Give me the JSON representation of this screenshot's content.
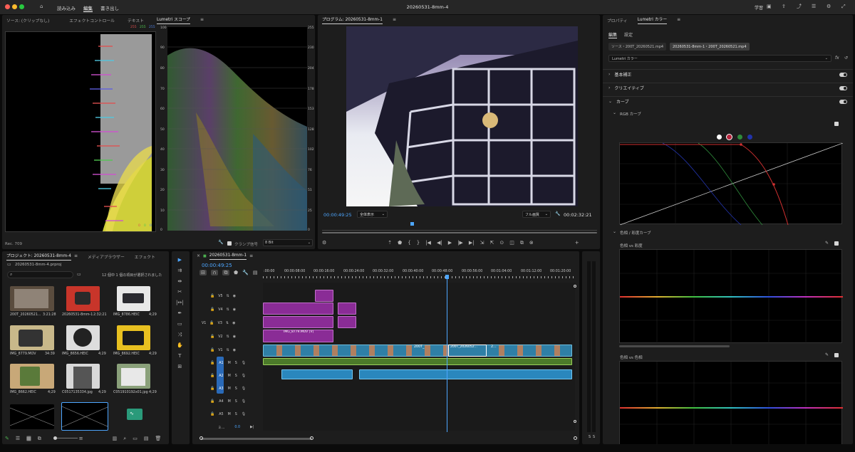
{
  "window": {
    "title": "20260531-8mm-4"
  },
  "menu": {
    "import": "読み込み",
    "edit": "編集",
    "export": "書き出し"
  },
  "titlebar_right": {
    "learn": "学習"
  },
  "source_panel": {
    "tabs": [
      "ソース: (クリップなし)",
      "エフェクトコントロール",
      "テキスト",
      "Lumetri スコープ"
    ],
    "histogram_scale": [
      "255",
      "255",
      "255"
    ],
    "histogram_bottom": [
      "0",
      "0",
      "0"
    ],
    "rec": "Rec. 709",
    "parade_left_scale": [
      "100",
      "90",
      "80",
      "70",
      "60",
      "50",
      "40",
      "30",
      "20",
      "10",
      "0"
    ],
    "parade_right_scale": [
      "255",
      "230",
      "204",
      "178",
      "153",
      "128",
      "102",
      "76",
      "51",
      "25",
      "0"
    ],
    "clamp_label": "クランプ信号",
    "bit_depth": "8 Bit"
  },
  "program": {
    "title": "プログラム: 20260531-8mm-1",
    "timecode": "00:00:49:25",
    "fit": "全体表示",
    "quality": "フル画質",
    "duration": "00:02:32:21"
  },
  "lumetri": {
    "tabs": [
      "プロパティ",
      "Lumetri カラー"
    ],
    "subtabs": [
      "編集",
      "設定"
    ],
    "source_clip": "ソース・200T_20260521.mp4",
    "seq_clip": "20260531-8mm-1・200T_20260521.mp4",
    "preset": "Lumetri カラー",
    "sections": [
      "基本補正",
      "クリエイティブ",
      "カーブ"
    ],
    "rgb_curve": "RGB カーブ",
    "hue_sat_curve": "色相 / 彩度カーブ",
    "hue_vs_sat": "色相 vs 彩度",
    "hue_vs_hue": "色相 vs 色相"
  },
  "project": {
    "tabs": [
      "プロジェクト: 20260531-8mm-4",
      "メディアブラウザー",
      "エフェクト"
    ],
    "file": "20260531-8mm-4.prproj",
    "selection": "12 個中 1 個の項目が選択されました",
    "items": [
      {
        "name": "200T_20260521...",
        "dur": "3:21:28"
      },
      {
        "name": "20260531-8mm-1",
        "dur": "2:32:21"
      },
      {
        "name": "IMG_8786.HEIC",
        "dur": "4;29"
      },
      {
        "name": "IMG_8779.MOV",
        "dur": "34:39"
      },
      {
        "name": "IMG_8656.HEIC",
        "dur": "4;29"
      },
      {
        "name": "IMG_8692.HEIC",
        "dur": "4;29"
      },
      {
        "name": "IMG_8662.HEIC",
        "dur": "4;29"
      },
      {
        "name": "C0517135334.jpg",
        "dur": "4;29"
      },
      {
        "name": "C051910192x01.jpg",
        "dur": "4;29"
      }
    ]
  },
  "timeline": {
    "title": "20260531-8mm-1",
    "timecode": "00:00:49:25",
    "ruler": [
      ":00:00",
      "00:00:08:00",
      "00:00:16:00",
      "00:00:24:00",
      "00:00:32:00",
      "00:00:40:00",
      "00:00:48:00",
      "00:00:56:00",
      "00:01:04:00",
      "00:01:12:00",
      "00:01:20:00"
    ],
    "video_tracks": [
      "V5",
      "V4",
      "V3",
      "V2",
      "V1"
    ],
    "audio_tracks": [
      "A1",
      "A2",
      "A3",
      "A4",
      "A5"
    ],
    "master": "ミ...",
    "master_val": "0.0",
    "clip_mov": "IMG_8779.MOV [V]",
    "clip_200t": "200T_",
    "clip_200t_long": "200T_2026052...",
    "clip_2": "2...",
    "v1_src": "V1"
  },
  "meters": [
    "S",
    "S"
  ]
}
